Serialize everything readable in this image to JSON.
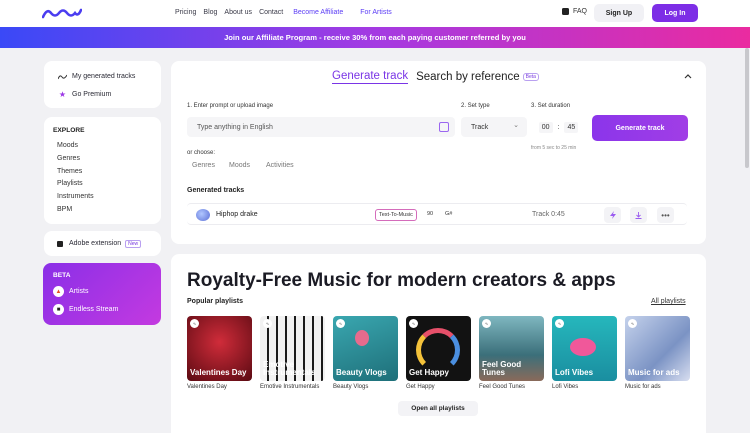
{
  "nav": {
    "links": [
      "Pricing",
      "Blog",
      "About us",
      "Contact"
    ],
    "accent_links": [
      "Become Affiliate",
      "For Artists"
    ],
    "faq": "FAQ",
    "signup": "Sign Up",
    "login": "Log In"
  },
  "banner": "Join our Affiliate Program - receive 30% from each paying customer referred by you",
  "sidebar": {
    "my_tracks": "My generated tracks",
    "premium": "Go Premium",
    "explore_title": "EXPLORE",
    "explore_items": [
      "Moods",
      "Genres",
      "Themes",
      "Playlists",
      "Instruments",
      "BPM"
    ],
    "adobe": "Adobe extension",
    "adobe_badge": "New",
    "beta_title": "BETA",
    "beta_items": [
      "Artists",
      "Endless Stream"
    ]
  },
  "generator": {
    "tab_active": "Generate track",
    "tab_other": "Search by reference",
    "tab_badge": "Beta",
    "label_prompt": "1. Enter prompt or upload image",
    "label_type": "2. Set type",
    "label_duration": "3. Set duration",
    "prompt_placeholder": "Type anything in English",
    "type_value": "Track",
    "duration_min": "00",
    "duration_sep": ":",
    "duration_sec": "45",
    "generate_button": "Generate track",
    "duration_hint": "from 5 sec to 25 min",
    "or_choose": "or choose:",
    "chips": [
      "Genres",
      "Moods",
      "Activities"
    ],
    "generated_title": "Generated tracks",
    "track": {
      "name": "Hiphop drake",
      "tag": "Text-To-Music",
      "kbps": "90",
      "key": "G#",
      "time": "Track 0:45"
    }
  },
  "catalog": {
    "hero": "Royalty-Free Music for modern creators & apps",
    "playlists_title": "Popular playlists",
    "all_playlists": "All playlists",
    "playlists": [
      {
        "overlay": "Valentines Day",
        "caption": "Valentines Day",
        "bg": "#8e1422"
      },
      {
        "overlay": "Emotive Instrumentals",
        "caption": "Emotive Instrumentals",
        "bg": "#2a2a2a"
      },
      {
        "overlay": "Beauty Vlogs",
        "caption": "Beauty Vlogs",
        "bg": "#2f8f98"
      },
      {
        "overlay": "Get Happy",
        "caption": "Get Happy",
        "bg": "#1b1b1b"
      },
      {
        "overlay": "Feel Good Tunes",
        "caption": "Feel Good Tunes",
        "bg": "#4f8a94"
      },
      {
        "overlay": "Lofi Vibes",
        "caption": "Lofi Vibes",
        "bg": "#2bb3b6"
      },
      {
        "overlay": "Music for ads",
        "caption": "Music for ads",
        "bg": "#a9b8d8"
      }
    ],
    "open_all": "Open all playlists"
  },
  "colors": {
    "accent": "#7a35e6",
    "login_bg": "#7d2ee6",
    "banner_start": "#3a49f7",
    "banner_end": "#ea2ba0"
  }
}
